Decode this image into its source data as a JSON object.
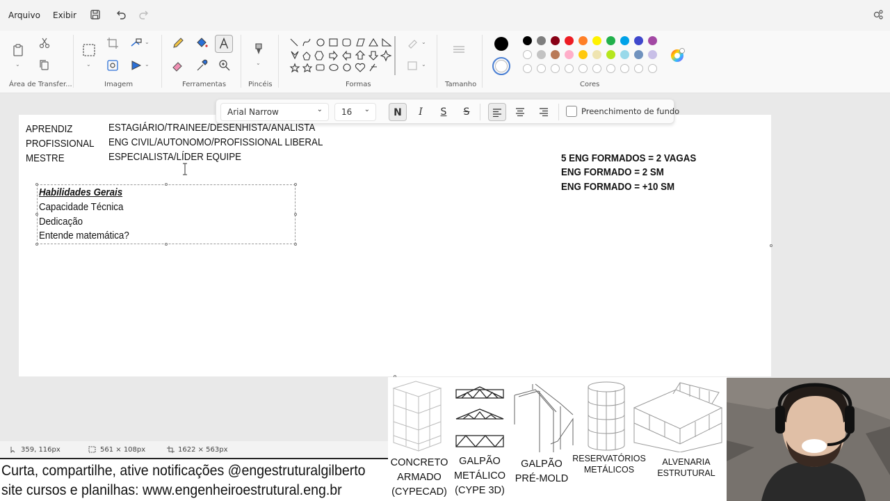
{
  "menu": {
    "file": "Arquivo",
    "view": "Exibir"
  },
  "ribbon": {
    "groups": {
      "clipboard": "Área de Transfer...",
      "image": "Imagem",
      "tools": "Ferramentas",
      "brushes": "Pincéis",
      "shapes": "Formas",
      "size": "Tamanho",
      "colors": "Cores"
    },
    "palette_row1": [
      "#000000",
      "#7f7f7f",
      "#880015",
      "#ed1c24",
      "#ff7f27",
      "#fff200",
      "#22b14c",
      "#00a2e8",
      "#3f48cc",
      "#a349a4"
    ],
    "palette_row2": [
      "#ffffff",
      "#c3c3c3",
      "#b97a57",
      "#ffaec9",
      "#ffc90e",
      "#efe4b0",
      "#b5e61d",
      "#99d9ea",
      "#7092be",
      "#c8bfe7"
    ],
    "color1": "#000000",
    "color2": "#ffffff"
  },
  "text_toolbar": {
    "font": "Arial Narrow",
    "size": "16",
    "bold": "N",
    "italic": "I",
    "underline": "S",
    "strike": "S",
    "fill_label": "Preenchimento de fundo"
  },
  "canvas": {
    "levels": [
      "APRENDIZ",
      "PROFISSIONAL",
      "MESTRE"
    ],
    "roles": [
      "ESTAGIÁRIO/TRAINEE/DESENHISTA/ANALISTA",
      "ENG CIVIL/AUTONOMO/PROFISSIONAL LIBERAL",
      "ESPECIALISTA/LÍDER EQUIPE"
    ],
    "stats": [
      "5 ENG FORMADOS = 2 VAGAS",
      "ENG FORMADO = 2 SM",
      "ENG FORMADO = +10 SM"
    ],
    "skills_title": "Habilidades Gerais",
    "skills": [
      "Capacidade Técnica",
      "Dedicação",
      "Entende matemática?"
    ]
  },
  "status": {
    "cursor": "359, 116px",
    "selection": "561 × 108px",
    "canvas_size": "1622 × 563px"
  },
  "banner": {
    "line1": "Curta, compartilhe, ative notificações @engestruturalgilberto",
    "line2": "site cursos e planilhas: www.engenheiroestrutural.eng.br"
  },
  "services": [
    {
      "line1": "CONCRETO",
      "line2": "ARMADO",
      "line3": "(CYPECAD)"
    },
    {
      "line1": "GALPÃO",
      "line2": "METÁLICO",
      "line3": "(CYPE 3D)"
    },
    {
      "line1": "GALPÃO",
      "line2": "PRÉ-MOLD"
    },
    {
      "line1": "RESERVATÓRIOS",
      "line2": "METÁLICOS"
    },
    {
      "line1": "ALVENARIA",
      "line2": "ESTRUTURAL"
    }
  ]
}
